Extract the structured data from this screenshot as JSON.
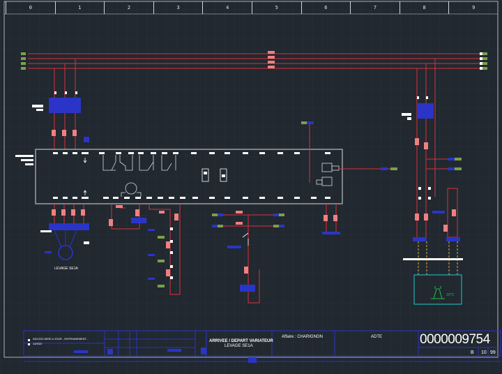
{
  "ruler": {
    "columns": [
      "0",
      "1",
      "2",
      "3",
      "4",
      "5",
      "6",
      "7",
      "8",
      "9"
    ]
  },
  "drawing": {
    "motor_label": "LEVAGE SE1A",
    "tank_label": "10°C"
  },
  "title_block": {
    "revision_1": "03/12/20 MISE A JOUR - ENTRAINEMENT...",
    "revision_2": "14/9/22",
    "drawing_title": "ARRIVEE / DEPART VARIATEUR",
    "drawing_subtitle": "LEVAGE SE1A",
    "affaire_label": "Affaire : CHARIGNON",
    "company": "ADTE",
    "drawing_number": "0000009754",
    "revision_letter": "B",
    "folio": "10",
    "folio_total": "99"
  },
  "colors": {
    "background": "#212830",
    "grid": "#2b333c",
    "wire": "#e0303a",
    "device": "#2a35c8",
    "outline": "#d6dbe0",
    "terminal_green": "#7aa04a",
    "contact_pink": "#f08080",
    "tank": "#20b0b0"
  }
}
